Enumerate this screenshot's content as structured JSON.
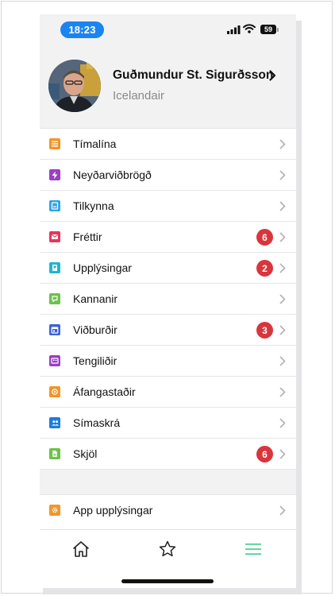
{
  "status_bar": {
    "time": "18:23",
    "battery": "59"
  },
  "profile": {
    "name": "Guðmundur St. Sigurðsson",
    "company": "Icelandair"
  },
  "menu": {
    "items": [
      {
        "label": "Tímalína",
        "icon": "timeline-icon",
        "color": "#f0962b",
        "badge": ""
      },
      {
        "label": "Neyðarviðbrögð",
        "icon": "lightning-icon",
        "color": "#9b3fc4",
        "badge": ""
      },
      {
        "label": "Tilkynna",
        "icon": "report-icon",
        "color": "#2ea5e8",
        "badge": ""
      },
      {
        "label": "Fréttir",
        "icon": "mail-icon",
        "color": "#e7365a",
        "badge": "6"
      },
      {
        "label": "Upplýsingar",
        "icon": "info-book-icon",
        "color": "#1fb6d1",
        "badge": "2"
      },
      {
        "label": "Kannanir",
        "icon": "survey-icon",
        "color": "#6cc24a",
        "badge": ""
      },
      {
        "label": "Viðburðir",
        "icon": "calendar-icon",
        "color": "#3d63d8",
        "badge": "3"
      },
      {
        "label": "Tengiliðir",
        "icon": "contact-card-icon",
        "color": "#9b3fc4",
        "badge": ""
      },
      {
        "label": "Áfangastaðir",
        "icon": "destination-icon",
        "color": "#f0962b",
        "badge": ""
      },
      {
        "label": "Símaskrá",
        "icon": "people-icon",
        "color": "#1a7de0",
        "badge": ""
      },
      {
        "label": "Skjöl",
        "icon": "document-icon",
        "color": "#6cc24a",
        "badge": "6"
      }
    ],
    "app_info": {
      "label": "App upplýsingar",
      "icon": "gear-icon",
      "color": "#f0962b"
    }
  },
  "tabbar": {
    "tabs": [
      {
        "name": "home",
        "icon": "home-icon"
      },
      {
        "name": "favorites",
        "icon": "star-icon"
      },
      {
        "name": "menu",
        "icon": "hamburger-icon",
        "active_color": "#3fc98a"
      }
    ]
  }
}
